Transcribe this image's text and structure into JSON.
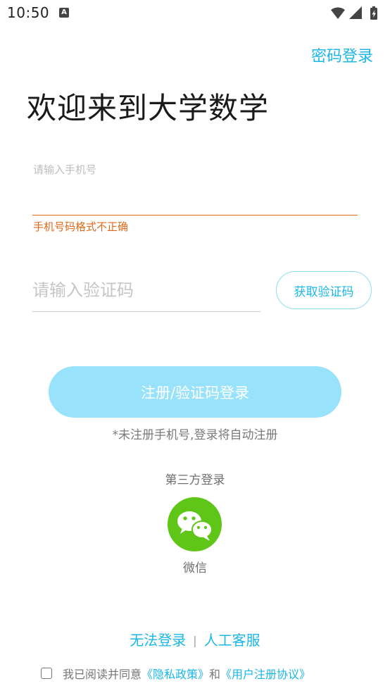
{
  "status_bar": {
    "time": "10:50",
    "notification_glyph": "A",
    "icons": [
      "wifi-icon",
      "signal-icon",
      "battery-charging-icon"
    ]
  },
  "header": {
    "password_login_link": "密码登录",
    "headline": "欢迎来到大学数学"
  },
  "phone": {
    "label": "请输入手机号",
    "value": "",
    "error": "手机号码格式不正确",
    "error_color": "#e06a1c"
  },
  "verification": {
    "placeholder": "请输入验证码",
    "value": "",
    "get_code_label": "获取验证码"
  },
  "register": {
    "button_label": "注册/验证码登录",
    "hint": "*未注册手机号,登录将自动注册"
  },
  "third_party": {
    "title": "第三方登录",
    "wechat_label": "微信",
    "wechat_color": "#5fc516"
  },
  "footer": {
    "cannot_login": "无法登录",
    "separator": "|",
    "customer_service": "人工客服"
  },
  "agreement": {
    "checked": false,
    "prefix": "我已阅读并同意",
    "privacy_policy": "《隐私政策》",
    "and": "和",
    "user_agreement": "《用户注册协议》"
  },
  "colors": {
    "accent": "#1bb7e6",
    "register_button": "#98e3fb"
  }
}
